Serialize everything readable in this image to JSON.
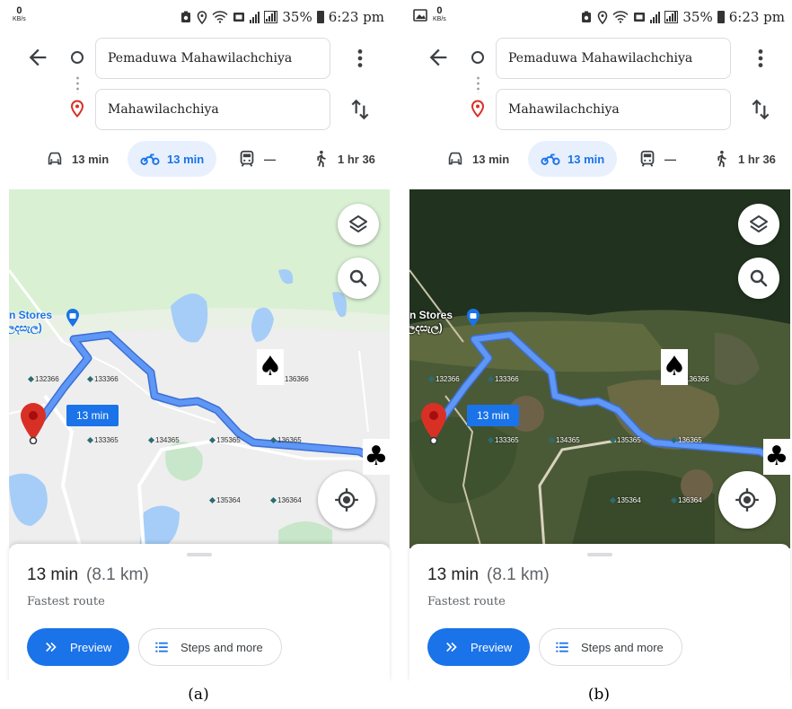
{
  "colors": {
    "accent": "#1a73e8",
    "route": "#5e97f6",
    "destination_pin": "#d93025",
    "map_land": "#eeeeee",
    "map_water": "#a5cdf7",
    "satellite_forest": "#21331f"
  },
  "status_bar": {
    "kb_value": "0",
    "kb_unit": "KB/s",
    "icons": [
      "battery-saver-icon",
      "location-icon",
      "wifi-icon",
      "cast-icon",
      "signal-icon"
    ],
    "battery": "35%",
    "time": "6:23 pm"
  },
  "directions": {
    "origin": "Pemaduwa Mahawilachchiya",
    "destination": "Mahawilachchiya",
    "back_icon": "arrow-back-icon",
    "menu_icon": "more-vert-icon",
    "swap_icon": "swap-vert-icon"
  },
  "modes": [
    {
      "icon": "car-icon",
      "label": "13 min",
      "selected": false
    },
    {
      "icon": "motorbike-icon",
      "label": "13 min",
      "selected": true
    },
    {
      "icon": "transit-icon",
      "label": "—",
      "selected": false
    },
    {
      "icon": "walk-icon",
      "label": "1 hr 36",
      "selected": false
    }
  ],
  "map": {
    "poi_label": "ron Stores",
    "poi_sublabel": "ළලදසැල)",
    "route_duration": "13 min",
    "grid_labels": [
      "132366",
      "133366",
      "133365",
      "134365",
      "135365",
      "136365",
      "135364",
      "136364",
      "136366"
    ],
    "markers": {
      "spade": "♠",
      "club": "♣"
    },
    "buttons": [
      "layers-icon",
      "search-icon",
      "my-location-icon"
    ]
  },
  "summary": {
    "duration": "13 min",
    "distance": "(8.1 km)",
    "subtitle": "Fastest route",
    "preview_label": "Preview",
    "steps_label": "Steps and more"
  },
  "panels": [
    {
      "caption": "(a)",
      "map_style": "default"
    },
    {
      "caption": "(b)",
      "map_style": "satellite"
    }
  ]
}
